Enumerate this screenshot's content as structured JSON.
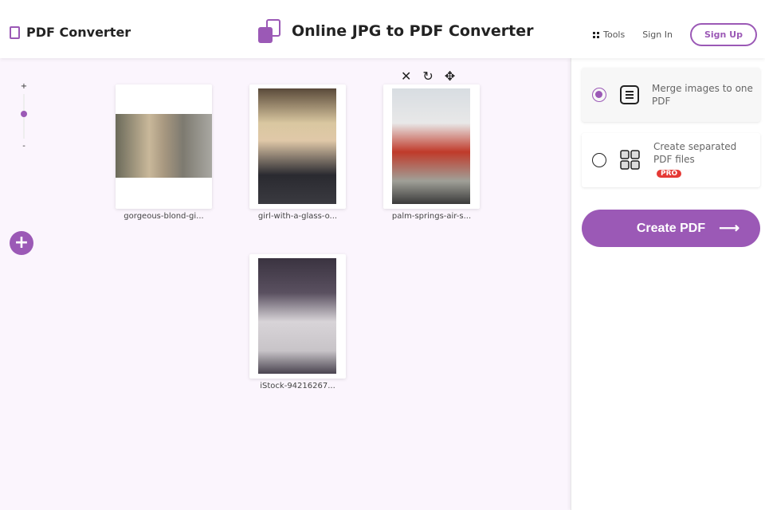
{
  "header": {
    "logo": "PDF Converter",
    "title": "Online JPG to PDF Converter",
    "nav": {
      "tools": "Tools",
      "sign_in": "Sign In",
      "sign_up": "Sign Up"
    }
  },
  "canvas": {
    "zoom": {
      "plus": "+",
      "minus": "-",
      "level": 0.7
    },
    "add_label": "+",
    "files": [
      {
        "name": "gorgeous-blond-gi..."
      },
      {
        "name": "girl-with-a-glass-o..."
      },
      {
        "name": "palm-springs-air-s..."
      },
      {
        "name": "iStock-94216267..."
      }
    ],
    "actions": {
      "remove": "✕",
      "rotate": "↻",
      "move": "✥"
    }
  },
  "sidebar": {
    "options": [
      {
        "label": "Merge images to one PDF",
        "selected": true
      },
      {
        "label": "Create separated PDF files",
        "badge": "PRO",
        "selected": false
      }
    ],
    "create_button": "Create PDF",
    "create_arrow": "⟶"
  },
  "colors": {
    "accent": "#9b59b6",
    "pro": "#e53935",
    "canvas_bg": "#fbf5fd"
  }
}
